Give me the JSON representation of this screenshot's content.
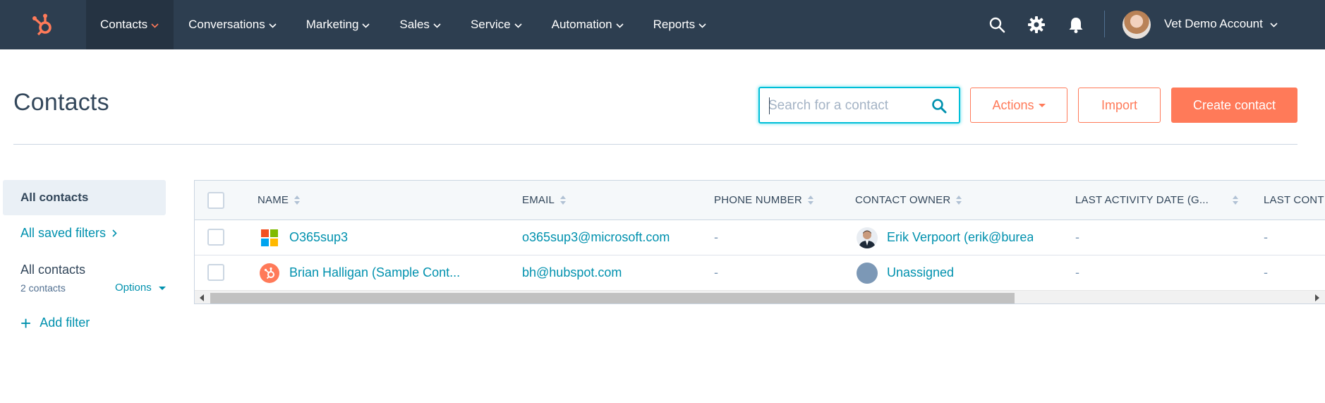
{
  "nav": {
    "items": [
      {
        "label": "Contacts",
        "active": true
      },
      {
        "label": "Conversations"
      },
      {
        "label": "Marketing"
      },
      {
        "label": "Sales"
      },
      {
        "label": "Service"
      },
      {
        "label": "Automation"
      },
      {
        "label": "Reports"
      }
    ],
    "account_name": "Vet Demo Account",
    "colors": {
      "bar": "#2d3e50",
      "accent": "#ff7a59"
    }
  },
  "header": {
    "title": "Contacts",
    "search_placeholder": "Search for a contact",
    "actions_label": "Actions",
    "import_label": "Import",
    "create_label": "Create contact"
  },
  "sidebar": {
    "all_contacts_label": "All contacts",
    "saved_filters_label": "All saved filters",
    "current_view": {
      "title": "All contacts",
      "count": "2 contacts",
      "options_label": "Options"
    },
    "add_filter_label": "Add filter"
  },
  "table": {
    "columns": [
      "NAME",
      "EMAIL",
      "PHONE NUMBER",
      "CONTACT OWNER",
      "LAST ACTIVITY DATE (G...",
      "LAST CONT"
    ],
    "rows": [
      {
        "name": "O365sup3",
        "email": "o365sup3@microsoft.com",
        "phone": "-",
        "owner": "Erik Verpoort (erik@burea",
        "last_activity": "-",
        "last_contacted": "-",
        "logo_icon": "microsoft-logo-icon",
        "owner_icon": "owner-photo-avatar"
      },
      {
        "name": "Brian Halligan (Sample Cont...",
        "email": "bh@hubspot.com",
        "phone": "-",
        "owner": "Unassigned",
        "last_activity": "-",
        "last_contacted": "-",
        "logo_icon": "hubspot-logo-icon",
        "owner_icon": "unassigned-avatar"
      }
    ]
  }
}
